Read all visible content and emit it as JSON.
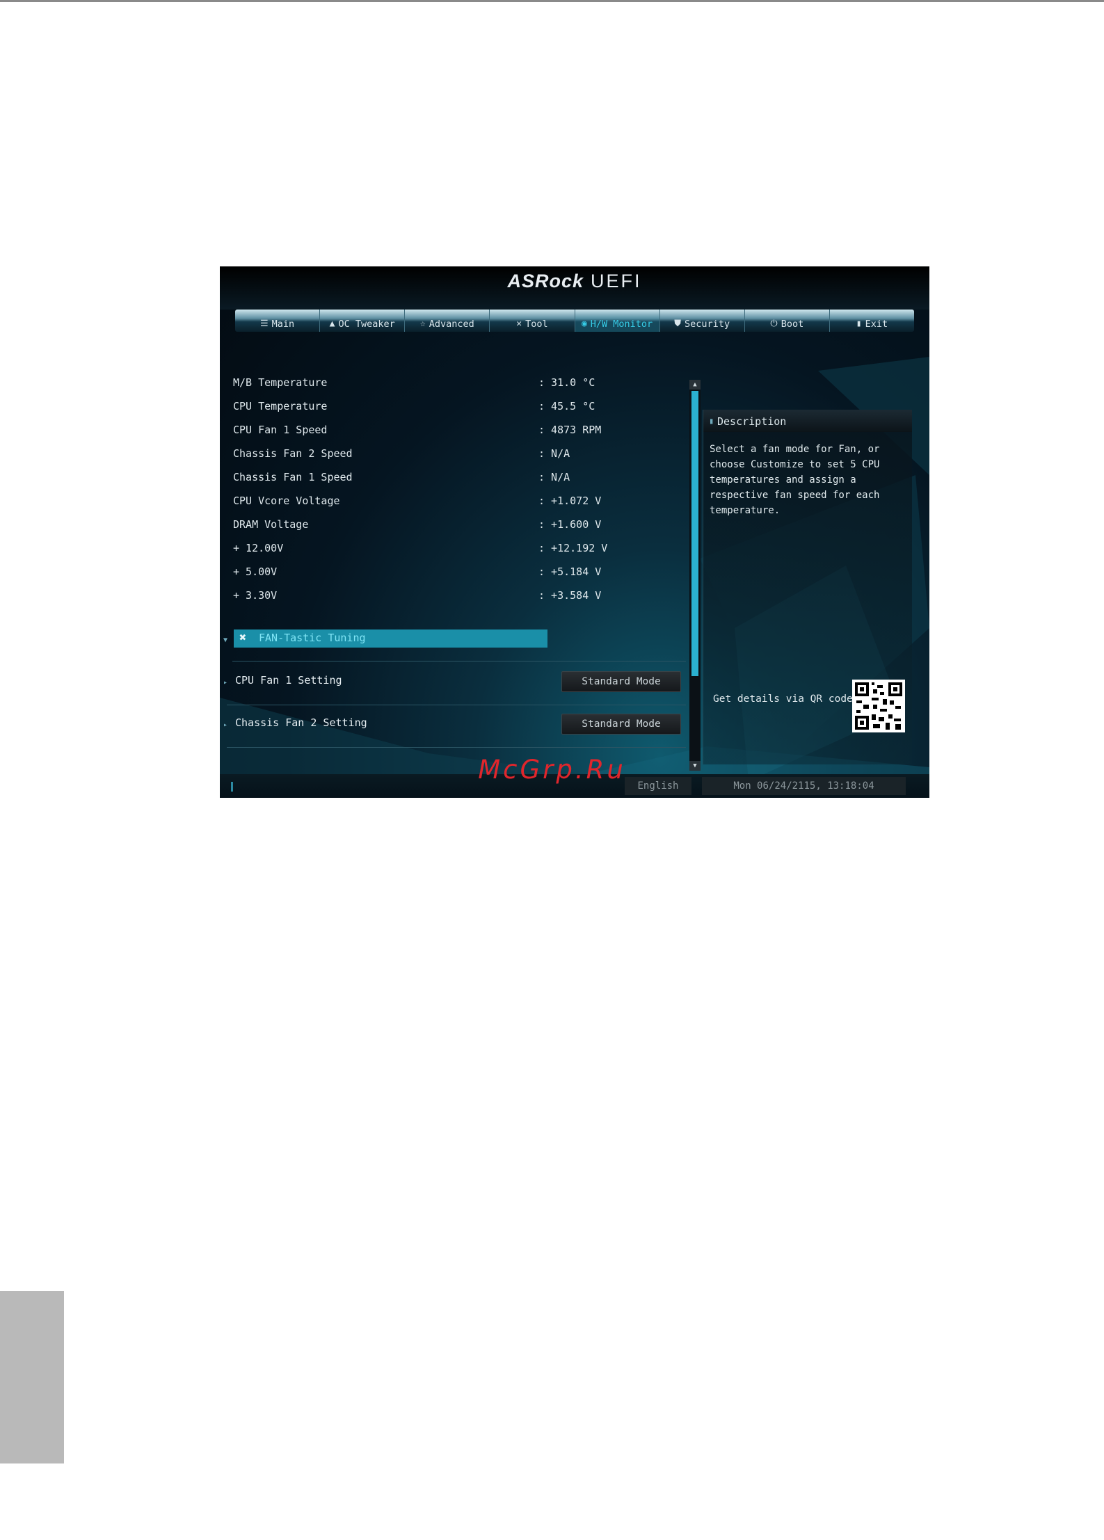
{
  "brand": {
    "logo": "ASRock",
    "product": "UEFI"
  },
  "tabs": [
    {
      "label": "Main",
      "icon": "list-icon",
      "active": false
    },
    {
      "label": "OC Tweaker",
      "icon": "flame-icon",
      "active": false
    },
    {
      "label": "Advanced",
      "icon": "star-icon",
      "active": false
    },
    {
      "label": "Tool",
      "icon": "tools-icon",
      "active": false
    },
    {
      "label": "H/W Monitor",
      "icon": "monitor-icon",
      "active": true
    },
    {
      "label": "Security",
      "icon": "shield-icon",
      "active": false
    },
    {
      "label": "Boot",
      "icon": "power-icon",
      "active": false
    },
    {
      "label": "Exit",
      "icon": "exit-icon",
      "active": false
    }
  ],
  "monitor": [
    {
      "label": "M/B Temperature",
      "value": ": 31.0 °C"
    },
    {
      "label": "CPU Temperature",
      "value": ": 45.5 °C"
    },
    {
      "label": "CPU Fan 1 Speed",
      "value": ": 4873 RPM"
    },
    {
      "label": "Chassis Fan 2 Speed",
      "value": ": N/A"
    },
    {
      "label": "Chassis Fan 1 Speed",
      "value": ": N/A"
    },
    {
      "label": "CPU Vcore Voltage",
      "value": ": +1.072 V"
    },
    {
      "label": "DRAM Voltage",
      "value": ": +1.600 V"
    },
    {
      "label": "+ 12.00V",
      "value": ": +12.192 V"
    },
    {
      "label": "+ 5.00V",
      "value": ": +5.184 V"
    },
    {
      "label": "+ 3.30V",
      "value": ": +3.584 V"
    }
  ],
  "fan_tastic": {
    "label": "FAN-Tastic Tuning"
  },
  "settings": [
    {
      "label": "CPU Fan 1 Setting",
      "value": "Standard Mode"
    },
    {
      "label": "Chassis Fan 2 Setting",
      "value": "Standard Mode"
    }
  ],
  "description": {
    "title": "Description",
    "text": "Select a fan mode for Fan, or choose Customize to set 5 CPU temperatures and assign a respective fan speed for each temperature.",
    "qr_label": "Get details via QR code"
  },
  "footer": {
    "language": "English",
    "datetime": "Mon 06/24/2115, 13:18:04"
  },
  "watermark": "McGrp.Ru",
  "colors": {
    "accent": "#2bb1d0",
    "highlight": "#1a8fa8",
    "watermark": "#e0262c"
  }
}
